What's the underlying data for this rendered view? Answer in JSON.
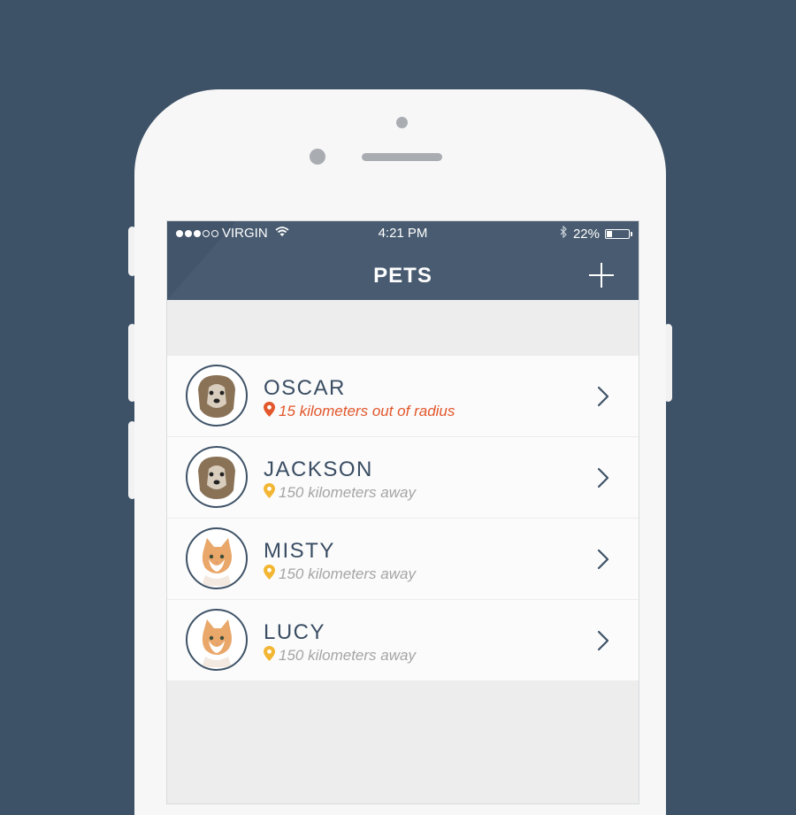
{
  "status_bar": {
    "carrier": "VIRGIN",
    "time": "4:21 PM",
    "battery": "22%",
    "battery_level": 0.22,
    "signal_bars_filled": 3,
    "signal_bars_total": 5
  },
  "navbar": {
    "title": "PETS",
    "add_icon": "plus-icon"
  },
  "pets": [
    {
      "name": "OSCAR",
      "distance": "15 kilometers out of radius",
      "status": "alert",
      "pin_color": "#e2572c",
      "photo": "dog-photo"
    },
    {
      "name": "JACKSON",
      "distance": "150 kilometers away",
      "status": "normal",
      "pin_color": "#f2b632",
      "photo": "dog-photo"
    },
    {
      "name": "MISTY",
      "distance": "150 kilometers away",
      "status": "normal",
      "pin_color": "#f2b632",
      "photo": "cat-photo"
    },
    {
      "name": "LUCY",
      "distance": "150 kilometers away",
      "status": "normal",
      "pin_color": "#f2b632",
      "photo": "cat-photo"
    }
  ],
  "colors": {
    "background": "#3e5267",
    "navbar": "#485b70",
    "name_text": "#3a4d63",
    "alert": "#e2572c",
    "pin": "#f2b632",
    "secondary_text": "#a5a5a5"
  }
}
